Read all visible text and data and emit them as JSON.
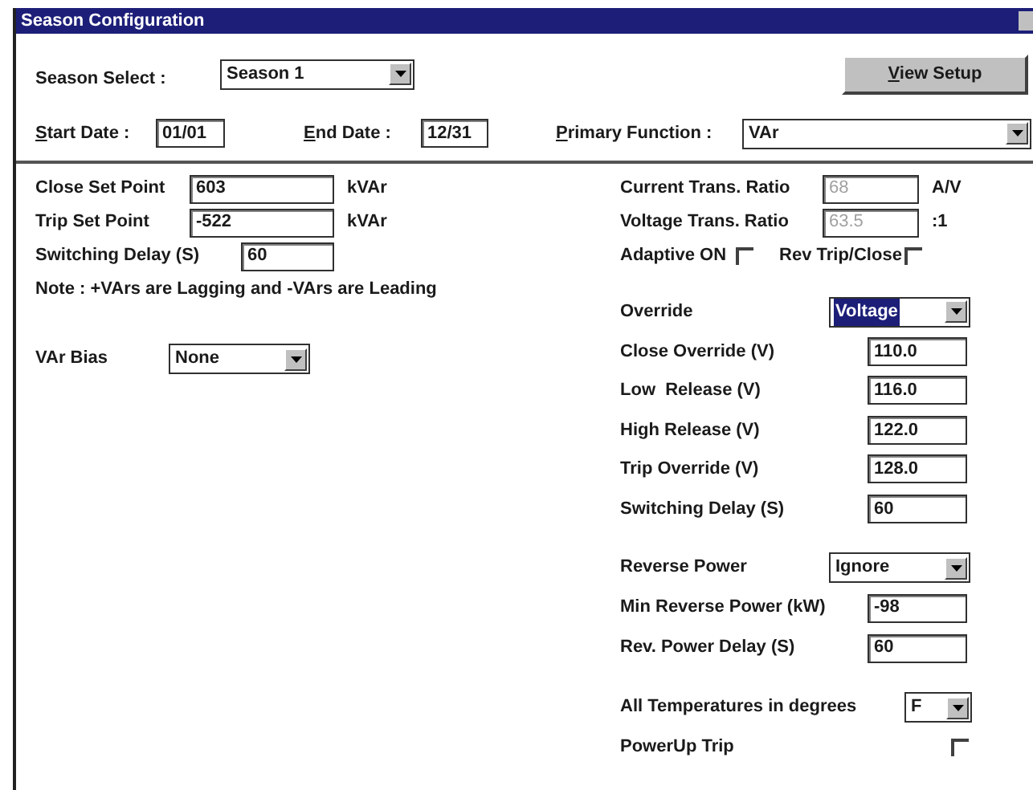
{
  "window": {
    "title": "Season Configuration"
  },
  "season_select": {
    "label": "Season Select :",
    "value": "Season 1"
  },
  "view_setup_button": {
    "label": "View Setup",
    "mnemonic": true
  },
  "dates": [
    {
      "label": "Start Date :",
      "value": "01/01",
      "mnemonic": true
    },
    {
      "label": "End Date :",
      "value": "12/31",
      "mnemonic": true
    }
  ],
  "primary_function": {
    "label": "Primary Function :",
    "value": "VAr",
    "mnemonic": true
  },
  "left_groups": [
    [
      {
        "kind": "text",
        "label": "Close Set Point",
        "value": "603",
        "unit": "kVAr",
        "disabled": false
      },
      {
        "kind": "text",
        "label": "Trip Set Point",
        "value": "-522",
        "unit": "kVAr",
        "disabled": false
      },
      {
        "kind": "text",
        "label": "Switching Delay (S)",
        "value": "60",
        "disabled": false
      },
      {
        "kind": "note",
        "text": "Note : +VArs are Lagging and -VArs are Leading"
      }
    ],
    [
      {
        "kind": "combo",
        "label": "VAr Bias",
        "value": "None",
        "highlighted": false
      }
    ]
  ],
  "right_groups": [
    [
      {
        "kind": "text",
        "label": "Current Trans. Ratio",
        "value": "68",
        "unit": "A/V",
        "disabled": true
      },
      {
        "kind": "text",
        "label": "Voltage Trans. Ratio",
        "value": "63.5",
        "unit": ":1",
        "disabled": true
      },
      {
        "kind": "checks",
        "items": [
          {
            "label": "Adaptive ON",
            "checked": false
          },
          {
            "label": "Rev Trip/Close",
            "checked": false
          }
        ]
      }
    ],
    [
      {
        "kind": "combo",
        "label": "Override",
        "value": "Voltage",
        "highlighted": true
      },
      {
        "kind": "text",
        "label": "Close Override (V)",
        "value": "110.0",
        "disabled": false
      },
      {
        "kind": "text",
        "label": "Low  Release (V)",
        "value": "116.0",
        "disabled": false
      },
      {
        "kind": "text",
        "label": "High Release (V)",
        "value": "122.0",
        "disabled": false
      },
      {
        "kind": "text",
        "label": "Trip Override (V)",
        "value": "128.0",
        "disabled": false
      },
      {
        "kind": "text",
        "label": "Switching Delay (S)",
        "value": "60",
        "disabled": false
      }
    ],
    [
      {
        "kind": "combo",
        "label": "Reverse Power",
        "value": "Ignore",
        "highlighted": false
      },
      {
        "kind": "text",
        "label": "Min Reverse Power (kW)",
        "value": "-98",
        "disabled": false
      },
      {
        "kind": "text",
        "label": "Rev. Power Delay (S)",
        "value": "60",
        "disabled": false
      }
    ],
    [
      {
        "kind": "combo",
        "label": "All Temperatures in degrees",
        "value": "F",
        "highlighted": false
      },
      {
        "kind": "checkbox",
        "label": "PowerUp Trip",
        "checked": false
      }
    ]
  ]
}
